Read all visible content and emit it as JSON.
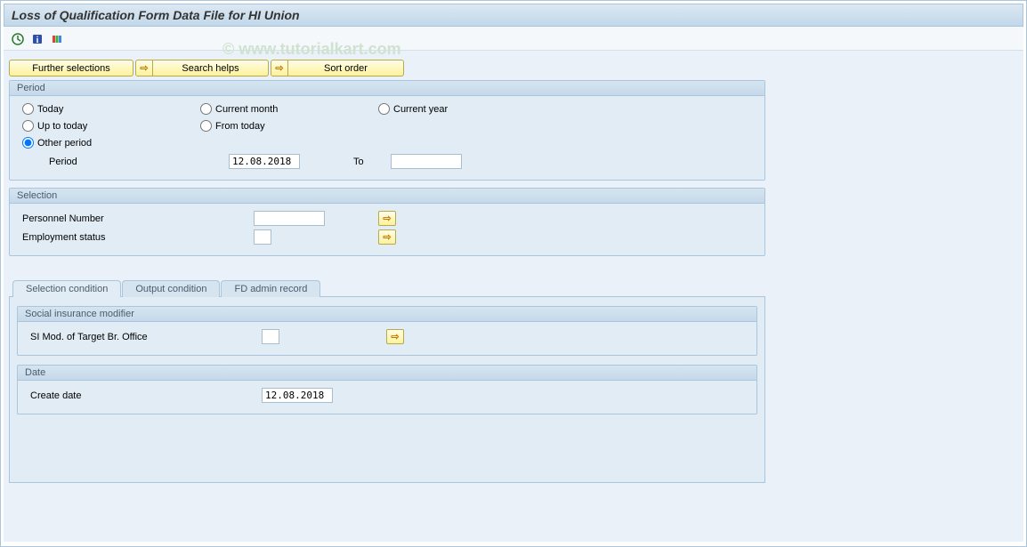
{
  "title": "Loss of Qualification Form Data File for HI Union",
  "watermark": "© www.tutorialkart.com",
  "buttons": {
    "further_selections": "Further selections",
    "search_helps": "Search helps",
    "sort_order": "Sort order"
  },
  "period": {
    "title": "Period",
    "today": "Today",
    "current_month": "Current month",
    "current_year": "Current year",
    "up_to_today": "Up to today",
    "from_today": "From today",
    "other_period": "Other period",
    "period_label": "Period",
    "period_from_value": "12.08.2018",
    "to_label": "To",
    "period_to_value": ""
  },
  "selection": {
    "title": "Selection",
    "personnel_number_label": "Personnel Number",
    "personnel_number_value": "",
    "employment_status_label": "Employment status",
    "employment_status_value": ""
  },
  "tabs": {
    "t1": "Selection condition",
    "t2": "Output condition",
    "t3": "FD admin record"
  },
  "si_modifier": {
    "title": "Social insurance modifier",
    "label": "SI Mod. of Target Br. Office",
    "value": ""
  },
  "date": {
    "title": "Date",
    "label": "Create date",
    "value": "12.08.2018"
  }
}
